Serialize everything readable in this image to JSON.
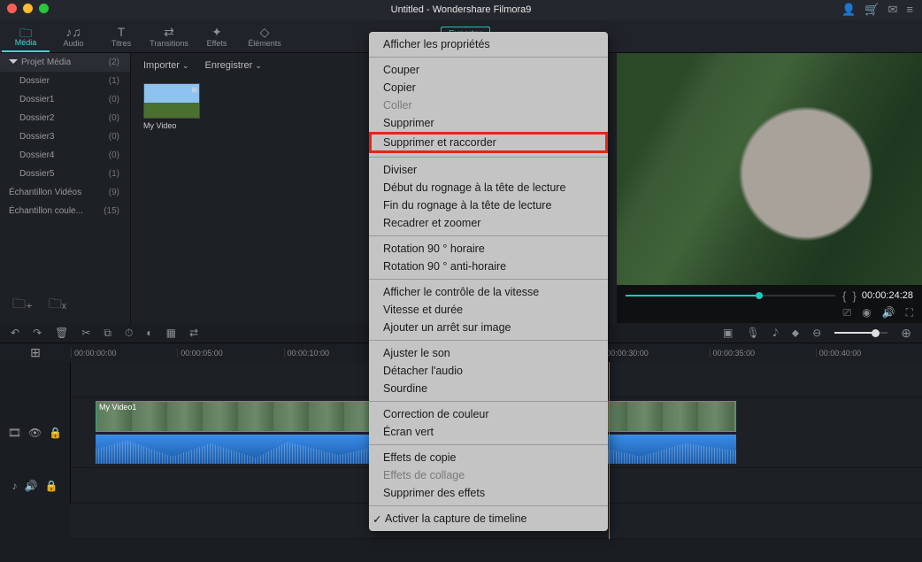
{
  "titlebar": {
    "title": "Untitled - Wondershare Filmora9"
  },
  "tabs": [
    {
      "label": "Média",
      "icon": "folder"
    },
    {
      "label": "Audio",
      "icon": "music"
    },
    {
      "label": "Titres",
      "icon": "text"
    },
    {
      "label": "Transitions",
      "icon": "transition"
    },
    {
      "label": "Effets",
      "icon": "sparkle"
    },
    {
      "label": "Éléments",
      "icon": "shapes"
    }
  ],
  "sidebar": {
    "root": {
      "name": "Projet Média",
      "count": "(2)"
    },
    "items": [
      {
        "name": "Dossier",
        "count": "(1)"
      },
      {
        "name": "Dossier1",
        "count": "(0)"
      },
      {
        "name": "Dossier2",
        "count": "(0)"
      },
      {
        "name": "Dossier3",
        "count": "(0)"
      },
      {
        "name": "Dossier4",
        "count": "(0)"
      },
      {
        "name": "Dossier5",
        "count": "(1)"
      }
    ],
    "extra": [
      {
        "name": "Échantillon Vidéos",
        "count": "(9)"
      },
      {
        "name": "Échantillon coule...",
        "count": "(15)"
      }
    ]
  },
  "mediaTop": {
    "import": "Importer",
    "save": "Enregistrer"
  },
  "mediaThumb": {
    "label": "My Video"
  },
  "export_btn": "Exporter",
  "preview": {
    "timecode": "00:00:24:28"
  },
  "ruler": {
    "ticks": [
      "00:00:00:00",
      "00:00:05:00",
      "00:00:10:00",
      "",
      "",
      "00:00:30:00",
      "00:00:35:00",
      "00:00:40:00"
    ]
  },
  "clip": {
    "label": "My Video1"
  },
  "context": {
    "items": [
      {
        "t": "Afficher les propriétés",
        "k": "props"
      },
      {
        "sep": true
      },
      {
        "t": "Couper",
        "k": "cut"
      },
      {
        "t": "Copier",
        "k": "copy"
      },
      {
        "t": "Coller",
        "k": "paste",
        "disabled": true
      },
      {
        "t": "Supprimer",
        "k": "delete"
      },
      {
        "t": "Supprimer et raccorder",
        "k": "ripple-delete",
        "highlight": true
      },
      {
        "sep": true
      },
      {
        "t": "Diviser",
        "k": "split"
      },
      {
        "t": "Début du rognage à la tête de lecture",
        "k": "trim-start"
      },
      {
        "t": "Fin du rognage à la tête de lecture",
        "k": "trim-end"
      },
      {
        "t": "Recadrer et zoomer",
        "k": "crop"
      },
      {
        "sep": true
      },
      {
        "t": "Rotation 90 ° horaire",
        "k": "rot-cw"
      },
      {
        "t": "Rotation 90 ° anti-horaire",
        "k": "rot-ccw"
      },
      {
        "sep": true
      },
      {
        "t": "Afficher le contrôle de la vitesse",
        "k": "speed-ctrl"
      },
      {
        "t": "Vitesse et durée",
        "k": "speed-dur"
      },
      {
        "t": "Ajouter un arrêt sur image",
        "k": "freeze"
      },
      {
        "sep": true
      },
      {
        "t": "Ajuster le son",
        "k": "adjust-audio"
      },
      {
        "t": "Détacher l'audio",
        "k": "detach-audio"
      },
      {
        "t": "Sourdine",
        "k": "mute"
      },
      {
        "sep": true
      },
      {
        "t": "Correction de couleur",
        "k": "color"
      },
      {
        "t": "Écran vert",
        "k": "green"
      },
      {
        "sep": true
      },
      {
        "t": "Effets de copie",
        "k": "copy-fx"
      },
      {
        "t": "Effets de collage",
        "k": "paste-fx",
        "disabled": true
      },
      {
        "t": "Supprimer des effets",
        "k": "remove-fx"
      },
      {
        "sep": true
      },
      {
        "t": "Activer la capture de timeline",
        "k": "snap",
        "check": true
      }
    ]
  }
}
